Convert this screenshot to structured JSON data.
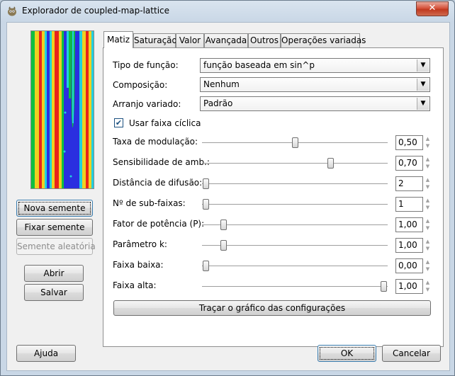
{
  "window": {
    "title": "Explorador de coupled-map-lattice",
    "close_glyph": "✕",
    "icon": "gimp-icon"
  },
  "left_panel": {
    "new_seed_button": "Nova semente",
    "fix_seed_button": "Fixar semente",
    "random_seed_button": "Semente aleatória",
    "open_button": "Abrir",
    "save_button": "Salvar"
  },
  "tabs": [
    {
      "label": "Matiz",
      "active": true
    },
    {
      "label": "Saturação",
      "active": false
    },
    {
      "label": "Valor",
      "active": false
    },
    {
      "label": "Avançada",
      "active": false
    },
    {
      "label": "Outros",
      "active": false
    },
    {
      "label": "Operações variadas",
      "active": false
    }
  ],
  "form": {
    "function_type_label": "Tipo de função:",
    "function_type_value": "função baseada em sin^p",
    "composition_label": "Composição:",
    "composition_value": "Nenhum",
    "misc_arrange_label": "Arranjo variado:",
    "misc_arrange_value": "Padrão",
    "use_cyclic_range_label": "Usar faixa cíclica",
    "use_cyclic_range_checked": true,
    "check_glyph": "✔",
    "combo_arrow_glyph": "▼",
    "spin_up_glyph": "▲",
    "spin_down_glyph": "▼",
    "plot_button": "Traçar o gráfico das configurações"
  },
  "sliders": [
    {
      "label": "Taxa de modulação:",
      "value": "0,50",
      "position": 0.5
    },
    {
      "label": "Sensibilidade de amb.:",
      "value": "0,70",
      "position": 0.7
    },
    {
      "label": "Distância de difusão:",
      "value": "2",
      "position": 0.0
    },
    {
      "label": "Nº de sub-faixas:",
      "value": "1",
      "position": 0.0
    },
    {
      "label": "Fator de potência (P):",
      "value": "1,00",
      "position": 0.1
    },
    {
      "label": "Parâmetro k:",
      "value": "1,00",
      "position": 0.1
    },
    {
      "label": "Faixa baixa:",
      "value": "0,00",
      "position": 0.0
    },
    {
      "label": "Faixa alta:",
      "value": "1,00",
      "position": 1.0
    }
  ],
  "bottom": {
    "help_button": "Ajuda",
    "ok_button": "OK",
    "cancel_button": "Cancelar"
  },
  "colors": {
    "preview_blue": "#2a2fe0",
    "preview_green": "#10c040",
    "preview_red": "#e8241c",
    "preview_yellow": "#f0d020",
    "preview_cyan": "#20d0e0"
  }
}
